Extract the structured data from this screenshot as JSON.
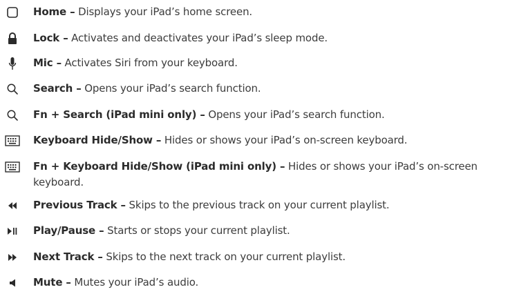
{
  "items": [
    {
      "icon": "home-square-icon",
      "term": "Home –",
      "desc": " Displays your iPad’s home screen."
    },
    {
      "icon": "lock-icon",
      "term": "Lock –",
      "desc": " Activates and deactivates your iPad’s sleep mode."
    },
    {
      "icon": "microphone-icon",
      "term": "Mic –",
      "desc": " Activates Siri from your keyboard."
    },
    {
      "icon": "search-icon",
      "term": "Search –",
      "desc": " Opens your iPad’s search function."
    },
    {
      "icon": "search-icon",
      "term": "Fn + Search (iPad mini only) –",
      "desc": " Opens your iPad’s search function."
    },
    {
      "icon": "keyboard-icon",
      "term": "Keyboard Hide/Show –",
      "desc": " Hides or shows your iPad’s on-screen keyboard."
    },
    {
      "icon": "keyboard-icon",
      "term": "Fn + Keyboard Hide/Show (iPad mini only) –",
      "desc": " Hides or shows your iPad’s on-screen keyboard."
    },
    {
      "icon": "previous-track-icon",
      "term": "Previous Track –",
      "desc": " Skips to the previous track on your current playlist."
    },
    {
      "icon": "play-pause-icon",
      "term": "Play/Pause –",
      "desc": " Starts or stops your current playlist."
    },
    {
      "icon": "next-track-icon",
      "term": "Next Track –",
      "desc": " Skips to the next track on your current playlist."
    },
    {
      "icon": "mute-icon",
      "term": "Mute –",
      "desc": " Mutes your iPad’s audio."
    }
  ],
  "colors": {
    "text": "#3c3c3c",
    "icon": "#2b2b2b"
  }
}
